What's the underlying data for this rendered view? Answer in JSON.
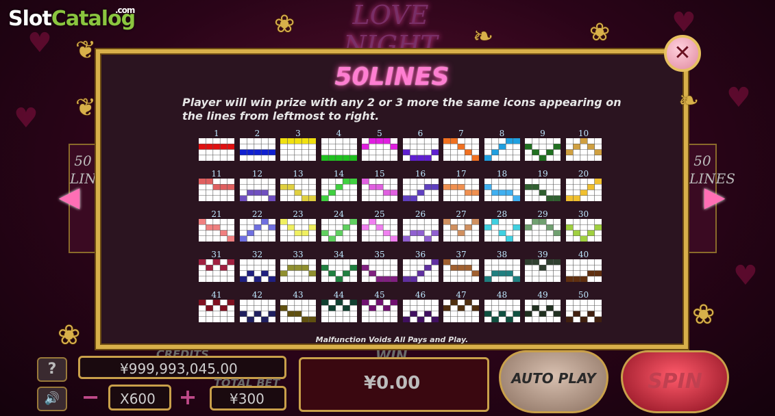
{
  "watermark": {
    "slot": "Slot",
    "catalog": "Catalog",
    "com": ".com"
  },
  "game_logo": "LOVE NIGHT",
  "side_panel": {
    "text": "50 LINES"
  },
  "paytable": {
    "title": "50LINES",
    "description": "Player will win prize with any 2 or 3  more the same icons appearing on the lines from leftmost to right.",
    "disclaimer": "Malfunction Voids All Pays and Play.",
    "close_icon": "close-icon",
    "lines": [
      {
        "n": "1",
        "color": "#e01010",
        "rows": [
          1,
          1,
          1,
          1,
          1
        ]
      },
      {
        "n": "2",
        "color": "#1020d0",
        "rows": [
          2,
          2,
          2,
          2,
          2
        ]
      },
      {
        "n": "3",
        "color": "#f0e010",
        "rows": [
          0,
          0,
          0,
          0,
          0
        ]
      },
      {
        "n": "4",
        "color": "#20c020",
        "rows": [
          3,
          3,
          3,
          3,
          3
        ]
      },
      {
        "n": "5",
        "color": "#e020e0",
        "rows": [
          1,
          0,
          0,
          0,
          1
        ]
      },
      {
        "n": "6",
        "color": "#6020d0",
        "rows": [
          2,
          3,
          3,
          3,
          2
        ]
      },
      {
        "n": "7",
        "color": "#f07020",
        "rows": [
          0,
          0,
          1,
          2,
          3
        ]
      },
      {
        "n": "8",
        "color": "#20a0e0",
        "rows": [
          3,
          2,
          1,
          0,
          0
        ]
      },
      {
        "n": "9",
        "color": "#207020",
        "rows": [
          1,
          2,
          3,
          2,
          1
        ]
      },
      {
        "n": "10",
        "color": "#d0a040",
        "rows": [
          2,
          1,
          0,
          1,
          2
        ]
      },
      {
        "n": "11",
        "color": "#e06060",
        "rows": [
          0,
          0,
          1,
          1,
          1
        ]
      },
      {
        "n": "12",
        "color": "#7050c0",
        "rows": [
          3,
          2,
          2,
          2,
          3
        ]
      },
      {
        "n": "13",
        "color": "#e0d040",
        "rows": [
          1,
          1,
          2,
          3,
          3
        ]
      },
      {
        "n": "14",
        "color": "#40d040",
        "rows": [
          3,
          2,
          1,
          0,
          0
        ]
      },
      {
        "n": "15",
        "color": "#e060e0",
        "rows": [
          0,
          1,
          1,
          2,
          2
        ]
      },
      {
        "n": "16",
        "color": "#6040c0",
        "rows": [
          3,
          3,
          2,
          1,
          1
        ]
      },
      {
        "n": "17",
        "color": "#f09050",
        "rows": [
          1,
          1,
          1,
          2,
          2
        ]
      },
      {
        "n": "18",
        "color": "#40b0f0",
        "rows": [
          1,
          2,
          2,
          2,
          3
        ]
      },
      {
        "n": "19",
        "color": "#306030",
        "rows": [
          1,
          1,
          2,
          3,
          3
        ]
      },
      {
        "n": "20",
        "color": "#f0c030",
        "rows": [
          3,
          3,
          2,
          1,
          0
        ]
      },
      {
        "n": "21",
        "color": "#f08080",
        "rows": [
          0,
          1,
          1,
          2,
          3
        ]
      },
      {
        "n": "22",
        "color": "#7070e0",
        "rows": [
          3,
          2,
          1,
          0,
          1
        ]
      },
      {
        "n": "23",
        "color": "#f0f060",
        "rows": [
          0,
          1,
          2,
          2,
          1
        ]
      },
      {
        "n": "24",
        "color": "#60d060",
        "rows": [
          2,
          3,
          2,
          1,
          0
        ]
      },
      {
        "n": "25",
        "color": "#f080f0",
        "rows": [
          1,
          0,
          1,
          2,
          3
        ]
      },
      {
        "n": "26",
        "color": "#9060d0",
        "rows": [
          3,
          2,
          2,
          3,
          2
        ]
      },
      {
        "n": "27",
        "color": "#d09060",
        "rows": [
          0,
          1,
          2,
          1,
          0
        ]
      },
      {
        "n": "28",
        "color": "#40d0e0",
        "rows": [
          1,
          0,
          2,
          3,
          1
        ]
      },
      {
        "n": "29",
        "color": "#70a070",
        "rows": [
          1,
          0,
          0,
          1,
          2
        ]
      },
      {
        "n": "30",
        "color": "#a0d040",
        "rows": [
          1,
          2,
          3,
          2,
          1
        ]
      },
      {
        "n": "31",
        "color": "#a02040",
        "rows": [
          0,
          1,
          0,
          1,
          0
        ]
      },
      {
        "n": "32",
        "color": "#202080",
        "rows": [
          3,
          2,
          3,
          2,
          3
        ]
      },
      {
        "n": "33",
        "color": "#909030",
        "rows": [
          2,
          1,
          1,
          1,
          2
        ]
      },
      {
        "n": "34",
        "color": "#208040",
        "rows": [
          1,
          2,
          3,
          2,
          1
        ]
      },
      {
        "n": "35",
        "color": "#802080",
        "rows": [
          1,
          2,
          3,
          3,
          3
        ]
      },
      {
        "n": "36",
        "color": "#6030a0",
        "rows": [
          3,
          3,
          2,
          1,
          0
        ]
      },
      {
        "n": "37",
        "color": "#a06030",
        "rows": [
          0,
          1,
          1,
          1,
          2
        ]
      },
      {
        "n": "38",
        "color": "#208080",
        "rows": [
          3,
          2,
          2,
          2,
          3
        ]
      },
      {
        "n": "39",
        "color": "#304030",
        "rows": [
          0,
          0,
          1,
          0,
          0
        ]
      },
      {
        "n": "40",
        "color": "#603010",
        "rows": [
          3,
          3,
          3,
          2,
          2
        ]
      },
      {
        "n": "41",
        "color": "#801020",
        "rows": [
          0,
          1,
          0,
          1,
          0
        ]
      },
      {
        "n": "42",
        "color": "#202060",
        "rows": [
          2,
          3,
          2,
          3,
          2
        ]
      },
      {
        "n": "43",
        "color": "#605010",
        "rows": [
          1,
          2,
          2,
          3,
          3
        ]
      },
      {
        "n": "44",
        "color": "#104030",
        "rows": [
          0,
          1,
          0,
          1,
          0
        ]
      },
      {
        "n": "45",
        "color": "#701070",
        "rows": [
          0,
          1,
          0,
          1,
          0
        ]
      },
      {
        "n": "46",
        "color": "#401060",
        "rows": [
          3,
          2,
          3,
          2,
          3
        ]
      },
      {
        "n": "47",
        "color": "#503010",
        "rows": [
          1,
          0,
          1,
          0,
          1
        ]
      },
      {
        "n": "48",
        "color": "#105040",
        "rows": [
          2,
          3,
          2,
          3,
          2
        ]
      },
      {
        "n": "49",
        "color": "#203020",
        "rows": [
          2,
          1,
          2,
          1,
          2
        ]
      },
      {
        "n": "50",
        "color": "#402010",
        "rows": [
          3,
          2,
          3,
          2,
          3
        ]
      }
    ]
  },
  "hud": {
    "credits_label": "CREDITS",
    "credits_value": "¥999,993,045.00",
    "bet_multiplier": "X600",
    "total_bet_label": "TOTAL BET",
    "total_bet_value": "¥300",
    "win_label": "WIN",
    "win_value": "¥0.00",
    "auto_play": "AUTO PLAY",
    "spin": "SPIN",
    "help_label": "?",
    "minus_label": "−",
    "plus_label": "+"
  },
  "colors": {
    "accent_gold": "#d8b04a",
    "pink": "#ff7ed2"
  }
}
